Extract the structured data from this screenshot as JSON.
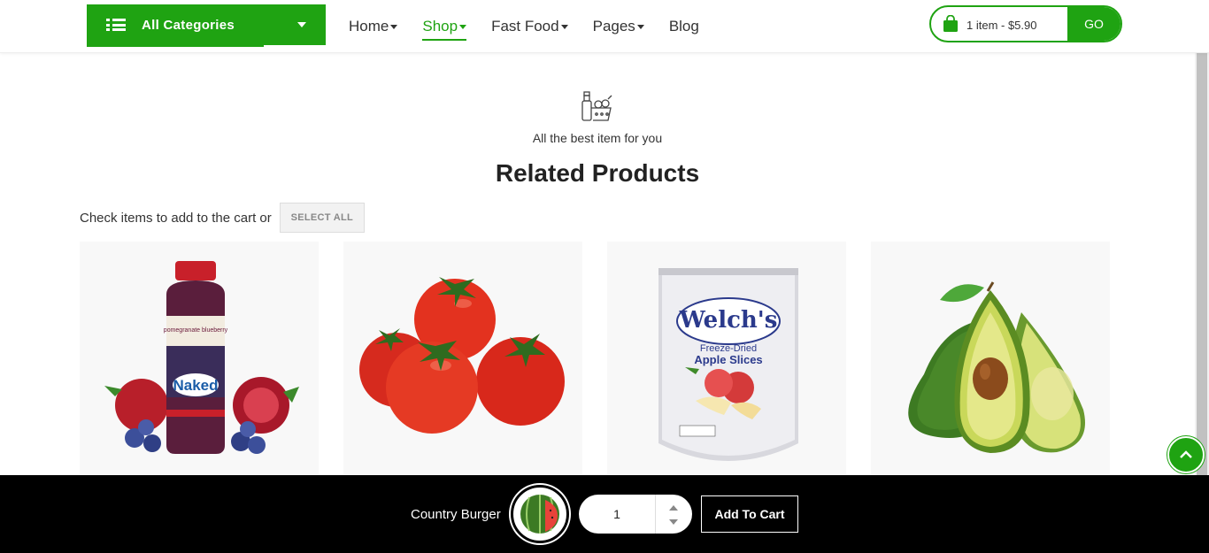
{
  "header": {
    "categories_label": "All Categories",
    "nav": [
      {
        "label": "Home"
      },
      {
        "label": "Shop"
      },
      {
        "label": "Fast Food"
      },
      {
        "label": "Pages"
      },
      {
        "label": "Blog"
      }
    ],
    "active_nav": "Shop",
    "cart_summary": "1 item - $5.90",
    "go_label": "GO"
  },
  "section": {
    "subtitle": "All the best item for you",
    "title": "Related Products",
    "check_text": "Check items to add to the cart or",
    "select_all_label": "SELECT ALL"
  },
  "products": [
    {
      "name": "naked-juice-bottle",
      "brand_text": "Naked",
      "label_text": "pomegranate blueberry"
    },
    {
      "name": "tomatoes"
    },
    {
      "name": "welchs-apple-slices",
      "brand_text": "Welch's",
      "label_text": "Freeze-Dried",
      "label_text2": "Apple Slices"
    },
    {
      "name": "avocado"
    }
  ],
  "sticky_bar": {
    "product_name": "Country Burger",
    "quantity": "1",
    "add_to_cart_label": "Add To Cart"
  },
  "colors": {
    "accent": "#1fa312",
    "sticky_bg": "#000000"
  }
}
